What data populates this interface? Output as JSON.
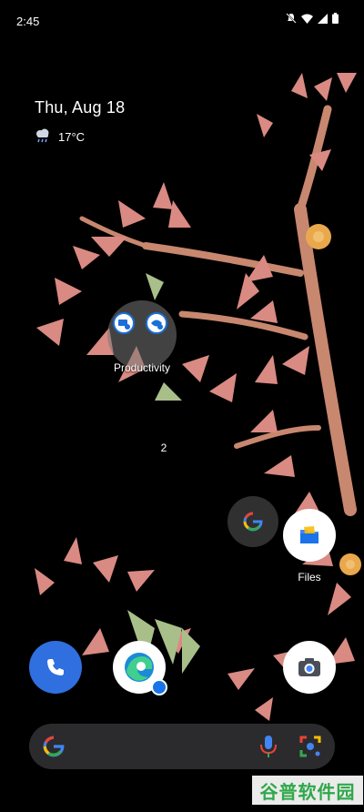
{
  "status_bar": {
    "time": "2:45",
    "icons": [
      "notifications-muted-icon",
      "wifi-icon",
      "signal-icon",
      "battery-icon"
    ]
  },
  "widget": {
    "date": "Thu, Aug 18",
    "weather_icon": "rain-cloud-icon",
    "temperature": "17°C"
  },
  "home": {
    "folder": {
      "label": "Productivity",
      "apps": [
        "remote-desktop-icon",
        "remote-desktop-icon"
      ]
    },
    "page_indicator": "2",
    "apps": [
      {
        "name": "google-app",
        "label": ""
      },
      {
        "name": "files-app",
        "label": "Files"
      }
    ]
  },
  "dock": {
    "apps": [
      "phone-app",
      "edge-work-app",
      "camera-app"
    ]
  },
  "search_bar": {
    "logo": "google-g-icon",
    "voice": "microphone-icon",
    "lens": "google-lens-icon"
  },
  "watermark": {
    "text": "谷普软件园"
  },
  "colors": {
    "background": "#000000",
    "search_bar": "#2b2b2e",
    "phone_app": "#2f6fe0",
    "watermark": "#2fa84a"
  }
}
